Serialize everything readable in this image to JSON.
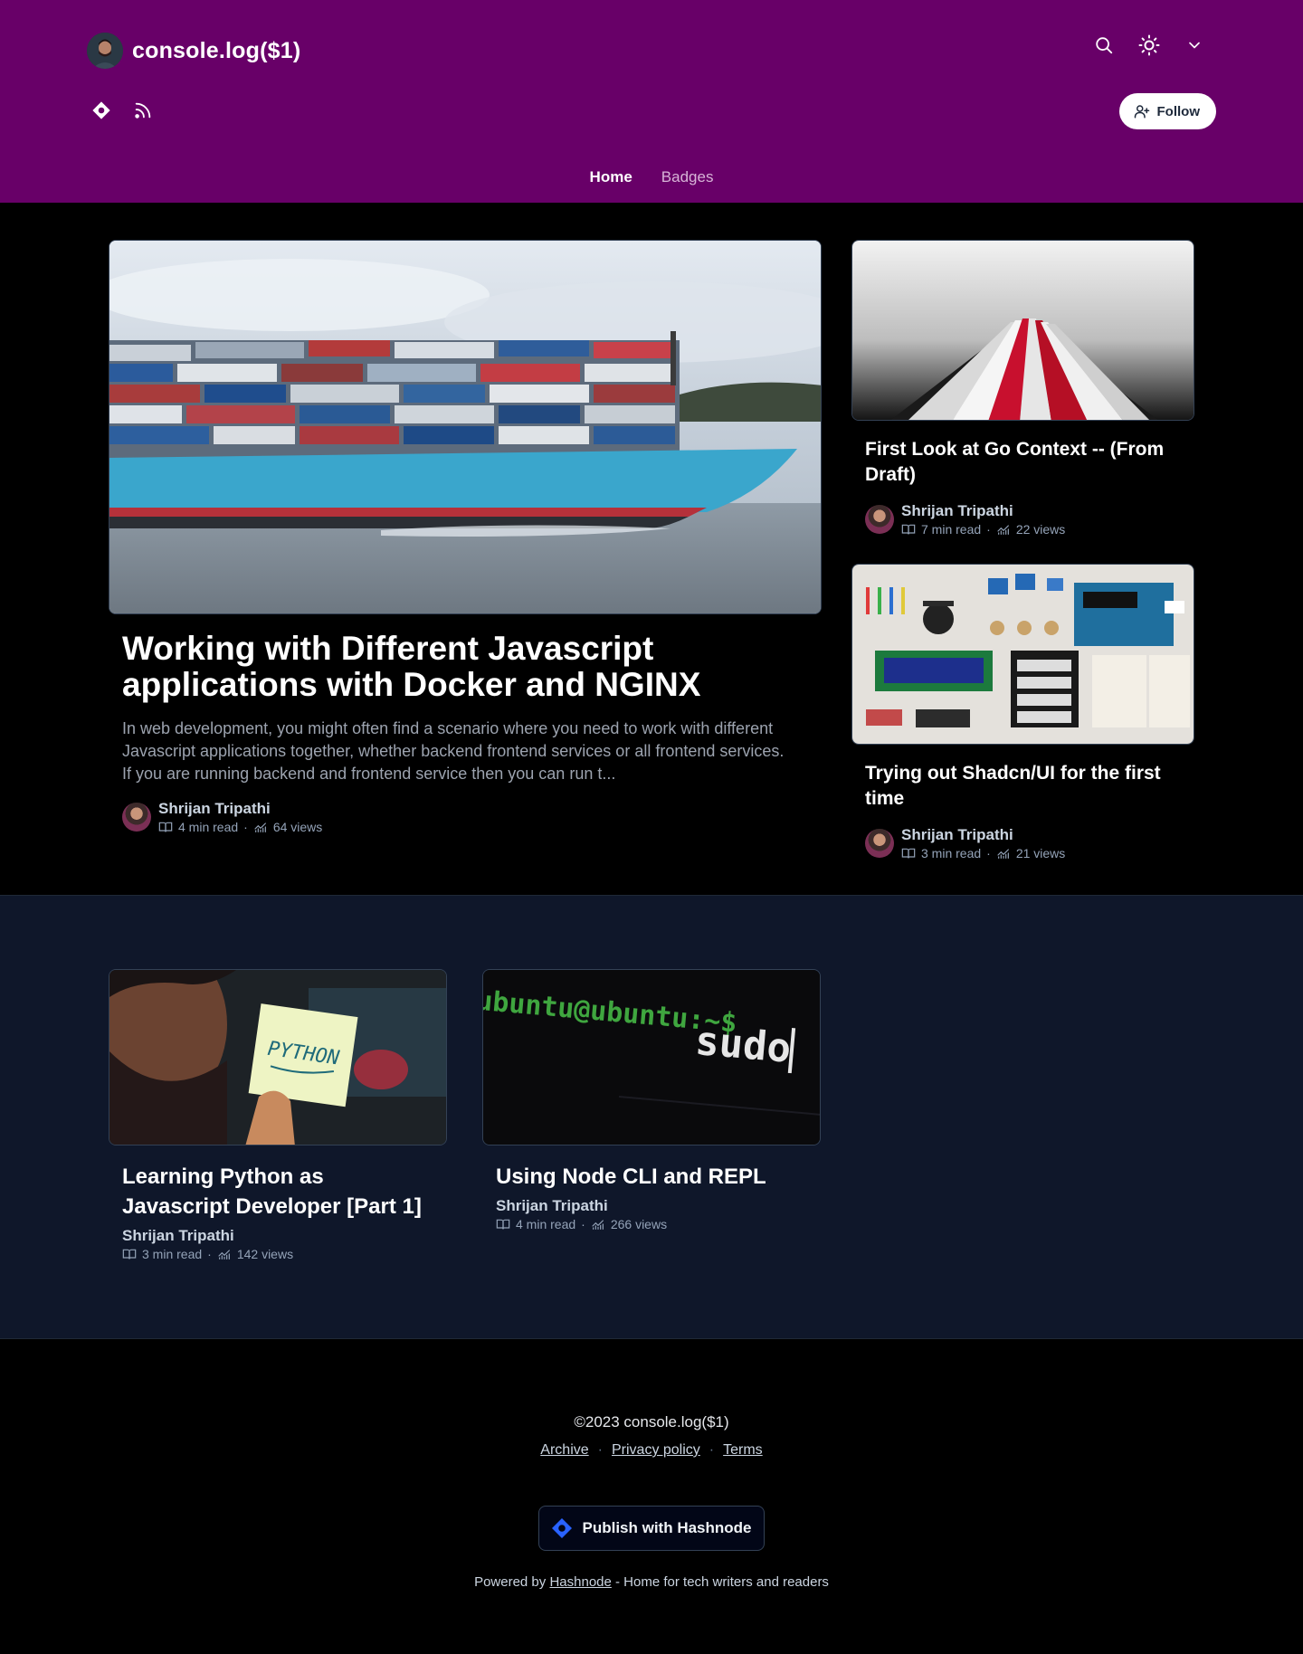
{
  "header": {
    "title": "console.log($1)",
    "follow_label": "Follow",
    "icons": [
      "search-icon",
      "sun-icon",
      "chevron-down-icon"
    ],
    "social_icons": [
      "hashnode-icon",
      "rss-icon"
    ]
  },
  "nav": {
    "tabs": [
      {
        "label": "Home",
        "active": true
      },
      {
        "label": "Badges",
        "active": false
      }
    ]
  },
  "featured": {
    "main": {
      "title": "Working with Different Javascript applications with Docker and NGINX",
      "excerpt": "In web development, you might often find a scenario where you need to work with different Javascript applications together, whether backend frontend services or all frontend services. If you are running backend and frontend service then you can run t...",
      "author": "Shrijan Tripathi",
      "read_time": "4 min read",
      "views": "64 views"
    },
    "side": [
      {
        "title": "First Look at Go Context -- (From Draft)",
        "author": "Shrijan Tripathi",
        "read_time": "7 min read",
        "views": "22 views"
      },
      {
        "title": "Trying out Shadcn/UI for the first time",
        "author": "Shrijan Tripathi",
        "read_time": "3 min read",
        "views": "21 views"
      }
    ]
  },
  "grid": [
    {
      "title": "Learning Python as Javascript Developer [Part 1]",
      "author": "Shrijan Tripathi",
      "read_time": "3 min read",
      "views": "142 views",
      "img_text": "PYTHON"
    },
    {
      "title": "Using Node CLI and REPL",
      "author": "Shrijan Tripathi",
      "read_time": "4 min read",
      "views": "266 views",
      "img_prompt": "ubuntu@ubuntu:~$",
      "img_cmd": "sudo"
    }
  ],
  "footer": {
    "copyright": "©2023 console.log($1)",
    "links": [
      "Archive",
      "Privacy policy",
      "Terms"
    ],
    "publish_label": "Publish with Hashnode",
    "powered_prefix": "Powered by",
    "powered_link": "Hashnode",
    "powered_suffix": "- Home for tech writers and readers"
  },
  "colors": {
    "header_bg": "#680068",
    "grid_bg": "#0f172a",
    "accent": "#2962ff"
  }
}
